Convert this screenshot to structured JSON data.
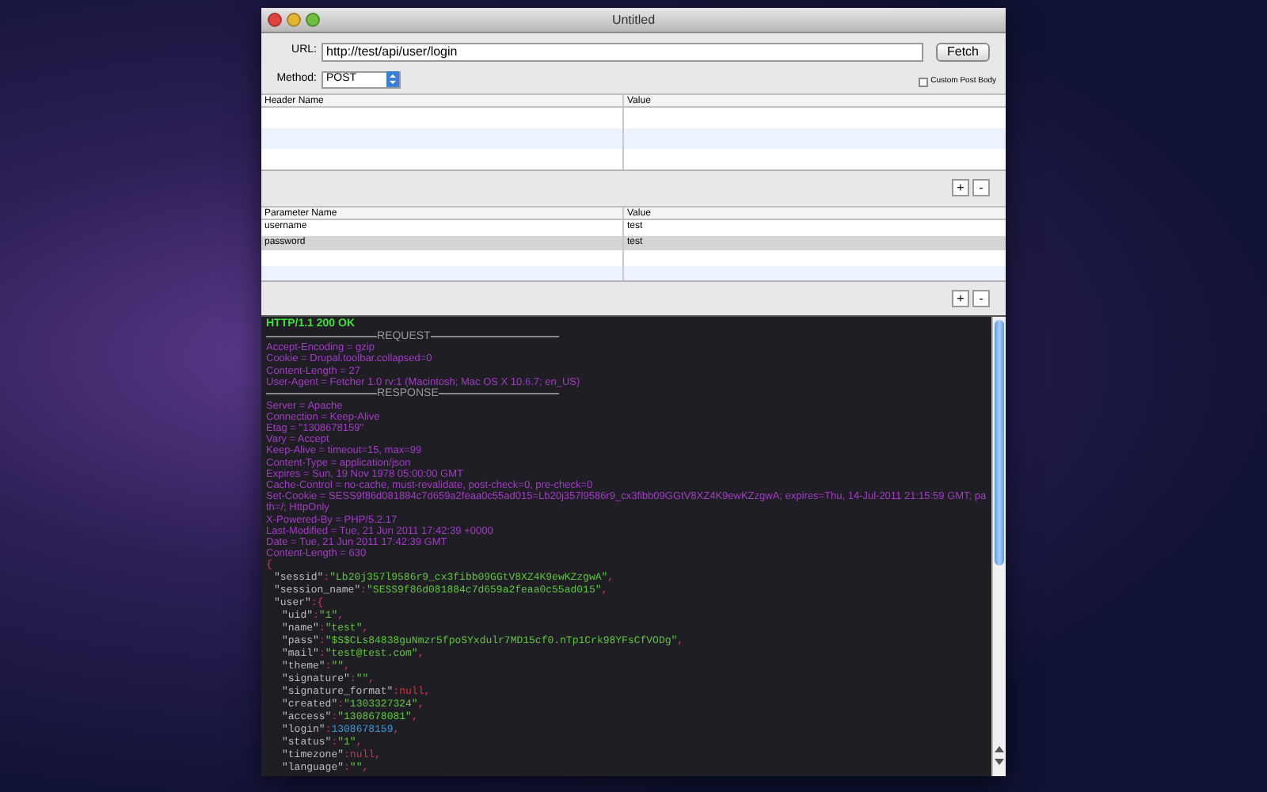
{
  "window": {
    "title": "Untitled"
  },
  "request": {
    "url_label": "URL:",
    "url": "http://test/api/user/login",
    "fetch_button": "Fetch",
    "method_label": "Method:",
    "method": "POST",
    "custom_post_body": {
      "label": "Custom Post Body",
      "checked": false
    }
  },
  "headers_table": {
    "columns": [
      "Header Name",
      "Value"
    ],
    "add_button": "+",
    "remove_button": "-"
  },
  "parameters_table": {
    "columns": [
      "Parameter Name",
      "Value"
    ],
    "rows": [
      {
        "cells": [
          "username",
          "test"
        ],
        "selected": false
      },
      {
        "cells": [
          "password",
          "test"
        ],
        "selected": true
      }
    ],
    "add_button": "+",
    "remove_button": "-"
  },
  "log": {
    "lines": [
      {
        "kind": "status",
        "text": "HTTP/1.1 200 OK"
      },
      {
        "kind": "divider",
        "text": "REQUEST"
      },
      {
        "kind": "header",
        "text": "Accept-Encoding = gzip"
      },
      {
        "kind": "header",
        "text": "Cookie = Drupal.toolbar.collapsed=0"
      },
      {
        "kind": "header",
        "text": "Content-Length = 27"
      },
      {
        "kind": "header",
        "text": "User-Agent = Fetcher 1.0 rv:1 (Macintosh; Mac OS X 10.6.7; en_US)"
      },
      {
        "kind": "divider",
        "text": "RESPONSE"
      },
      {
        "kind": "header",
        "text": "Server = Apache"
      },
      {
        "kind": "header",
        "text": "Connection = Keep-Alive"
      },
      {
        "kind": "header",
        "text": "Etag = \"1308678159\""
      },
      {
        "kind": "header",
        "text": "Vary = Accept"
      },
      {
        "kind": "header",
        "text": "Keep-Alive = timeout=15, max=99"
      },
      {
        "kind": "header",
        "text": "Content-Type = application/json"
      },
      {
        "kind": "header",
        "text": "Expires = Sun, 19 Nov 1978 05:00:00 GMT"
      },
      {
        "kind": "header",
        "text": "Cache-Control = no-cache, must-revalidate, post-check=0, pre-check=0"
      },
      {
        "kind": "header",
        "text": "Set-Cookie = SESS9f86d081884c7d659a2feaa0c55ad015=Lb20j357l9586r9_cx3fibb09GGtV8XZ4K9ewKZzgwA; expires=Thu, 14-Jul-2011 21:15:59 GMT; path=/; HttpOnly"
      },
      {
        "kind": "header",
        "text": "X-Powered-By = PHP/5.2.17"
      },
      {
        "kind": "header",
        "text": "Last-Modified = Tue, 21 Jun 2011 17:42:39 +0000"
      },
      {
        "kind": "header",
        "text": "Date = Tue, 21 Jun 2011 17:42:39 GMT"
      },
      {
        "kind": "header",
        "text": "Content-Length = 630"
      },
      {
        "kind": "json",
        "tokens": [
          {
            "text": "{",
            "kind": "punct"
          }
        ],
        "children": [
          {
            "tokens": [
              {
                "text": "\"sessid\"",
                "kind": "key"
              },
              {
                "text": ":",
                "kind": "punct"
              },
              {
                "text": "\"Lb20j357l9586r9_cx3fibb09GGtV8XZ4K9ewKZzgwA\"",
                "kind": "string"
              },
              {
                "text": ",",
                "kind": "punct"
              }
            ]
          },
          {
            "tokens": [
              {
                "text": "\"session_name\"",
                "kind": "key"
              },
              {
                "text": ":",
                "kind": "punct"
              },
              {
                "text": "\"SESS9f86d081884c7d659a2feaa0c55ad015\"",
                "kind": "string"
              },
              {
                "text": ",",
                "kind": "punct"
              }
            ]
          },
          {
            "tokens": [
              {
                "text": "\"user\"",
                "kind": "key"
              },
              {
                "text": ":{",
                "kind": "punct"
              }
            ],
            "children": [
              {
                "tokens": [
                  {
                    "text": "\"uid\"",
                    "kind": "key"
                  },
                  {
                    "text": ":",
                    "kind": "punct"
                  },
                  {
                    "text": "\"1\"",
                    "kind": "string"
                  },
                  {
                    "text": ",",
                    "kind": "punct"
                  }
                ]
              },
              {
                "tokens": [
                  {
                    "text": "\"name\"",
                    "kind": "key"
                  },
                  {
                    "text": ":",
                    "kind": "punct"
                  },
                  {
                    "text": "\"test\"",
                    "kind": "string"
                  },
                  {
                    "text": ",",
                    "kind": "punct"
                  }
                ]
              },
              {
                "tokens": [
                  {
                    "text": "\"pass\"",
                    "kind": "key"
                  },
                  {
                    "text": ":",
                    "kind": "punct"
                  },
                  {
                    "text": "\"$S$CLs84838guNmzr5fpoSYxdulr7MD15cf0.nTp1Crk98YFsCfVODg\"",
                    "kind": "string"
                  },
                  {
                    "text": ",",
                    "kind": "punct"
                  }
                ]
              },
              {
                "tokens": [
                  {
                    "text": "\"mail\"",
                    "kind": "key"
                  },
                  {
                    "text": ":",
                    "kind": "punct"
                  },
                  {
                    "text": "\"test@test.com\"",
                    "kind": "string"
                  },
                  {
                    "text": ",",
                    "kind": "punct"
                  }
                ]
              },
              {
                "tokens": [
                  {
                    "text": "\"theme\"",
                    "kind": "key"
                  },
                  {
                    "text": ":",
                    "kind": "punct"
                  },
                  {
                    "text": "\"\"",
                    "kind": "string"
                  },
                  {
                    "text": ",",
                    "kind": "punct"
                  }
                ]
              },
              {
                "tokens": [
                  {
                    "text": "\"signature\"",
                    "kind": "key"
                  },
                  {
                    "text": ":",
                    "kind": "punct"
                  },
                  {
                    "text": "\"\"",
                    "kind": "string"
                  },
                  {
                    "text": ",",
                    "kind": "punct"
                  }
                ]
              },
              {
                "tokens": [
                  {
                    "text": "\"signature_format\"",
                    "kind": "key"
                  },
                  {
                    "text": ":",
                    "kind": "punct"
                  },
                  {
                    "text": "null",
                    "kind": "null"
                  },
                  {
                    "text": ",",
                    "kind": "punct"
                  }
                ]
              },
              {
                "tokens": [
                  {
                    "text": "\"created\"",
                    "kind": "key"
                  },
                  {
                    "text": ":",
                    "kind": "punct"
                  },
                  {
                    "text": "\"1303327324\"",
                    "kind": "string"
                  },
                  {
                    "text": ",",
                    "kind": "punct"
                  }
                ]
              },
              {
                "tokens": [
                  {
                    "text": "\"access\"",
                    "kind": "key"
                  },
                  {
                    "text": ":",
                    "kind": "punct"
                  },
                  {
                    "text": "\"1308678081\"",
                    "kind": "string"
                  },
                  {
                    "text": ",",
                    "kind": "punct"
                  }
                ]
              },
              {
                "tokens": [
                  {
                    "text": "\"login\"",
                    "kind": "key"
                  },
                  {
                    "text": ":",
                    "kind": "punct"
                  },
                  {
                    "text": "1308678159",
                    "kind": "number"
                  },
                  {
                    "text": ",",
                    "kind": "punct"
                  }
                ]
              },
              {
                "tokens": [
                  {
                    "text": "\"status\"",
                    "kind": "key"
                  },
                  {
                    "text": ":",
                    "kind": "punct"
                  },
                  {
                    "text": "\"1\"",
                    "kind": "string"
                  },
                  {
                    "text": ",",
                    "kind": "punct"
                  }
                ]
              },
              {
                "tokens": [
                  {
                    "text": "\"timezone\"",
                    "kind": "key"
                  },
                  {
                    "text": ":",
                    "kind": "punct"
                  },
                  {
                    "text": "null",
                    "kind": "null"
                  },
                  {
                    "text": ",",
                    "kind": "punct"
                  }
                ]
              },
              {
                "tokens": [
                  {
                    "text": "\"language\"",
                    "kind": "key"
                  },
                  {
                    "text": ":",
                    "kind": "punct"
                  },
                  {
                    "text": "\"\"",
                    "kind": "string"
                  },
                  {
                    "text": ",",
                    "kind": "punct"
                  }
                ]
              }
            ]
          }
        ]
      }
    ]
  }
}
